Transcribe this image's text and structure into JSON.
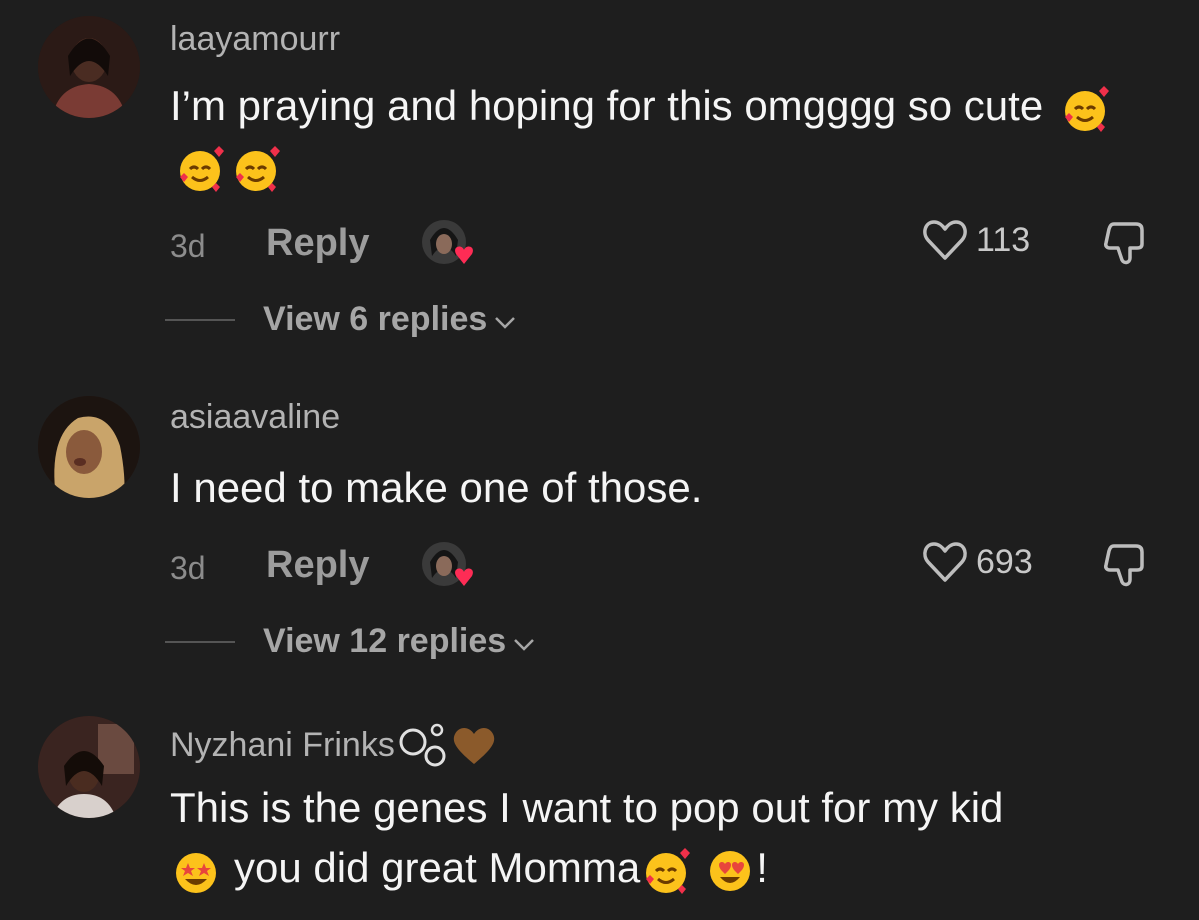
{
  "comments": [
    {
      "username": "laayamourr",
      "text": "I’m praying and hoping for this omgggg so cute",
      "text_emojis": [
        "smiling-face-with-hearts",
        "smiling-face-with-hearts",
        "smiling-face-with-hearts"
      ],
      "age": "3d",
      "reply_label": "Reply",
      "liked_by_creator": true,
      "likes": "113",
      "view_replies": "View 6 replies"
    },
    {
      "username": "asiaavaline",
      "text": "I need to make one of those.",
      "age": "3d",
      "reply_label": "Reply",
      "liked_by_creator": true,
      "likes": "693",
      "view_replies": "View 12 replies"
    },
    {
      "username": "Nyzhani Frinks",
      "username_emojis": [
        "bubbles",
        "brown-heart"
      ],
      "text_line1": "This is the genes I want to pop out for my kid",
      "text_line2_emoji_lead": "star-struck",
      "text_line2": "you did great Momma",
      "text_line2_emojis": [
        "smiling-face-with-hearts",
        "heart-eyes"
      ],
      "text_line2_end": "!"
    }
  ],
  "colors": {
    "background": "#1e1e1e",
    "username": "#b3b3b3",
    "text": "#f5f5f5",
    "muted": "#8c8c8c",
    "heart_red": "#fe2c55"
  }
}
